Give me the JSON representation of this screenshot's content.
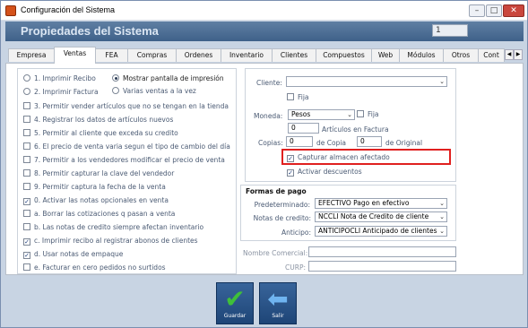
{
  "window": {
    "title": "Configuración del Sistema",
    "min": "–",
    "max": "□",
    "close": "✕"
  },
  "banner": {
    "title": "Propiedades del Sistema",
    "value": "1"
  },
  "tabs": [
    "Empresa",
    "Ventas",
    "FEA",
    "Compras",
    "Ordenes",
    "Inventario",
    "Clientes",
    "Compuestos",
    "Web",
    "Módulos",
    "Otros",
    "Cont"
  ],
  "active_tab": "Ventas",
  "left": {
    "radios": [
      {
        "label": "1. Imprimir Recibo",
        "checked": false
      },
      {
        "label": "Mostrar pantalla de impresión",
        "checked": true
      },
      {
        "label": "2. Imprimir Factura",
        "checked": false
      },
      {
        "label": "Varias ventas a la vez",
        "checked": false
      }
    ],
    "checks": [
      {
        "label": "3. Permitir vender artículos que no se tengan en la tienda",
        "checked": false
      },
      {
        "label": "4. Registrar los datos de artículos nuevos",
        "checked": false
      },
      {
        "label": "5. Permitir al cliente que exceda su credito",
        "checked": false
      },
      {
        "label": "6. El precio de venta varia segun el tipo de cambio del día",
        "checked": false
      },
      {
        "label": "7. Permitir a los vendedores modificar el precio de venta",
        "checked": false
      },
      {
        "label": "8. Permitir capturar la clave del vendedor",
        "checked": false
      },
      {
        "label": "9. Permitir captura la fecha de la venta",
        "checked": false
      },
      {
        "label": "0. Activar las notas opcionales en venta",
        "checked": true
      },
      {
        "label": "a. Borrar las cotizaciones q pasan a venta",
        "checked": false
      },
      {
        "label": "b. Las notas de credito siempre afectan inventario",
        "checked": false
      },
      {
        "label": "c. Imprimir recibo al registrar abonos de clientes",
        "checked": true
      },
      {
        "label": "d. Usar notas de empaque",
        "checked": true
      },
      {
        "label": "e. Facturar en cero pedidos no surtidos",
        "checked": false
      }
    ]
  },
  "right": {
    "cliente_label": "Cliente:",
    "cliente_value": "",
    "fija_label": "Fija",
    "moneda_label": "Moneda:",
    "moneda_value": "Pesos",
    "fija2_label": "Fija",
    "articulos_value": "0",
    "articulos_label": "Artículos en Factura",
    "copias_label": "Copias:",
    "copias_value": "0",
    "de_copia_label": "de Copia",
    "original_value": "0",
    "de_original_label": "de Original",
    "capturar_label": "Capturar almacen afectado",
    "capturar_checked": true,
    "descuentos_label": "Activar descuentos",
    "descuentos_checked": true
  },
  "formas": {
    "title": "Formas de pago",
    "predeterminado_label": "Predeterminado:",
    "predeterminado_value": "EFECTIVO Pago en efectivo",
    "notas_label": "Notas de credito:",
    "notas_value": "NCCLI Nota de Credito de cliente",
    "anticipo_label": "Anticipo:",
    "anticipo_value": "ANTICIPOCLI Anticipado de clientes"
  },
  "bottom_fields": {
    "nombre_label": "Nombre Comercial:",
    "curp_label": "CURP:"
  },
  "buttons": {
    "guardar": "Guardar",
    "salir": "Salir"
  }
}
